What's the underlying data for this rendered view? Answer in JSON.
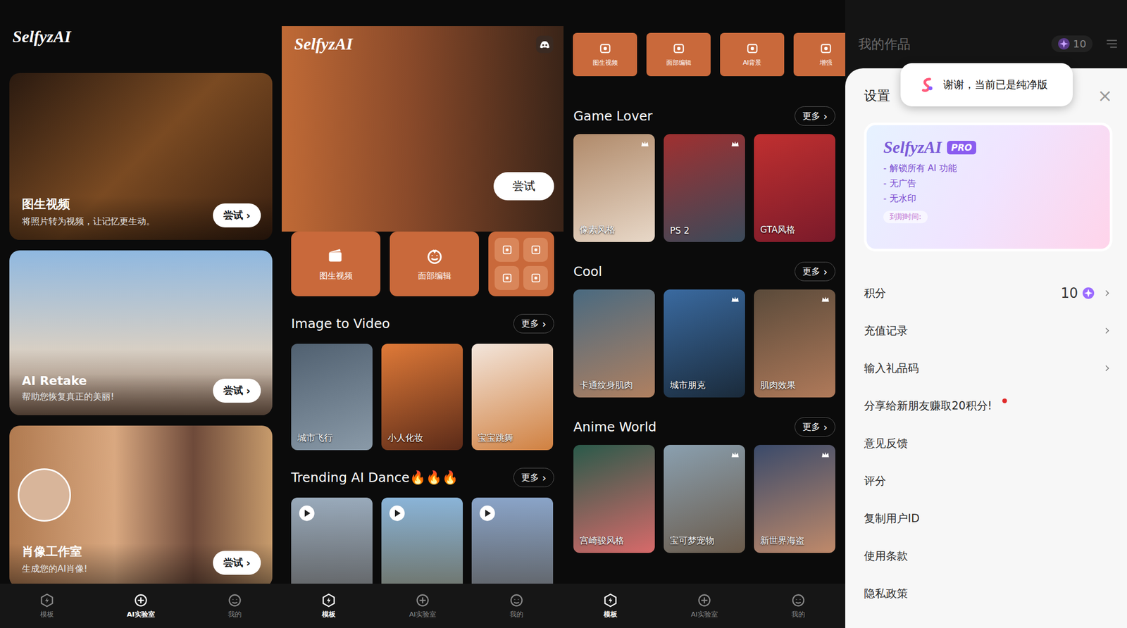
{
  "panel_home": {
    "logo": "SelfyzAI",
    "cards": [
      {
        "title": "图生视频",
        "subtitle": "将照片转为视频，让记忆更生动。",
        "button": "尝试",
        "avatar": false
      },
      {
        "title": "AI Retake",
        "subtitle": "帮助您恢复真正的美丽!",
        "button": "尝试",
        "avatar": false
      },
      {
        "title": "肖像工作室",
        "subtitle": "生成您的AI肖像!",
        "button": "尝试",
        "avatar": true
      }
    ],
    "nav": [
      {
        "label": "模板",
        "selected": false
      },
      {
        "label": "AI实验室",
        "selected": true
      },
      {
        "label": "我的",
        "selected": false
      }
    ]
  },
  "panel_templates": {
    "logo": "SelfyzAI",
    "hero_button": "尝试",
    "tools": [
      {
        "label": "图生视频"
      },
      {
        "label": "面部编辑"
      }
    ],
    "sections": [
      {
        "title": "Image to Video",
        "more": "更多",
        "items": [
          {
            "label": "城市飞行",
            "video": false
          },
          {
            "label": "小人化妆",
            "video": false
          },
          {
            "label": "宝宝跳舞",
            "video": false
          }
        ]
      },
      {
        "title": "Trending AI Dance🔥🔥🔥",
        "more": "更多",
        "items": [
          {
            "label": "",
            "video": true
          },
          {
            "label": "",
            "video": true
          },
          {
            "label": "",
            "video": true
          }
        ]
      }
    ],
    "nav": [
      {
        "label": "模板",
        "selected": true
      },
      {
        "label": "AI实验室",
        "selected": false
      },
      {
        "label": "我的",
        "selected": false
      }
    ]
  },
  "panel_styles": {
    "tools": [
      {
        "label": "图生视频"
      },
      {
        "label": "面部编辑"
      },
      {
        "label": "AI背景"
      },
      {
        "label": "增强"
      }
    ],
    "sections": [
      {
        "title": "Game Lover",
        "more": "更多",
        "items": [
          {
            "label": "像素风格",
            "premium": true
          },
          {
            "label": "PS 2",
            "premium": true
          },
          {
            "label": "GTA风格",
            "premium": false
          }
        ]
      },
      {
        "title": "Cool",
        "more": "更多",
        "items": [
          {
            "label": "卡通纹身肌肉",
            "premium": false
          },
          {
            "label": "城市朋克",
            "premium": true
          },
          {
            "label": "肌肉效果",
            "premium": true
          }
        ]
      },
      {
        "title": "Anime World",
        "more": "更多",
        "items": [
          {
            "label": "宫崎骏风格",
            "premium": false
          },
          {
            "label": "宝可梦宠物",
            "premium": true
          },
          {
            "label": "新世界海盗",
            "premium": true
          }
        ]
      }
    ],
    "nav": [
      {
        "label": "模板",
        "selected": true
      },
      {
        "label": "AI实验室",
        "selected": false
      },
      {
        "label": "我的",
        "selected": false
      }
    ]
  },
  "panel_settings": {
    "header": "我的作品",
    "points": "10",
    "toast": "谢谢，当前已是纯净版",
    "title": "设置",
    "close": "×",
    "pro": {
      "brand": "SelfyzAI",
      "badge": "PRO",
      "features": [
        "- 解锁所有 AI 功能",
        "- 无广告",
        "- 无水印"
      ],
      "expiry": "到期时间:"
    },
    "rows": [
      {
        "label": "积分",
        "value": "10",
        "chevron": true,
        "dot": false
      },
      {
        "label": "充值记录",
        "value": "",
        "chevron": true,
        "dot": false
      },
      {
        "label": "输入礼品码",
        "value": "",
        "chevron": true,
        "dot": false
      },
      {
        "label": "分享给新朋友赚取20积分!",
        "value": "",
        "chevron": false,
        "dot": true
      },
      {
        "label": "意见反馈",
        "value": "",
        "chevron": false,
        "dot": false
      },
      {
        "label": "评分",
        "value": "",
        "chevron": false,
        "dot": false
      },
      {
        "label": "复制用户ID",
        "value": "",
        "chevron": false,
        "dot": false
      },
      {
        "label": "使用条款",
        "value": "",
        "chevron": false,
        "dot": false
      },
      {
        "label": "隐私政策",
        "value": "",
        "chevron": false,
        "dot": false
      }
    ]
  }
}
